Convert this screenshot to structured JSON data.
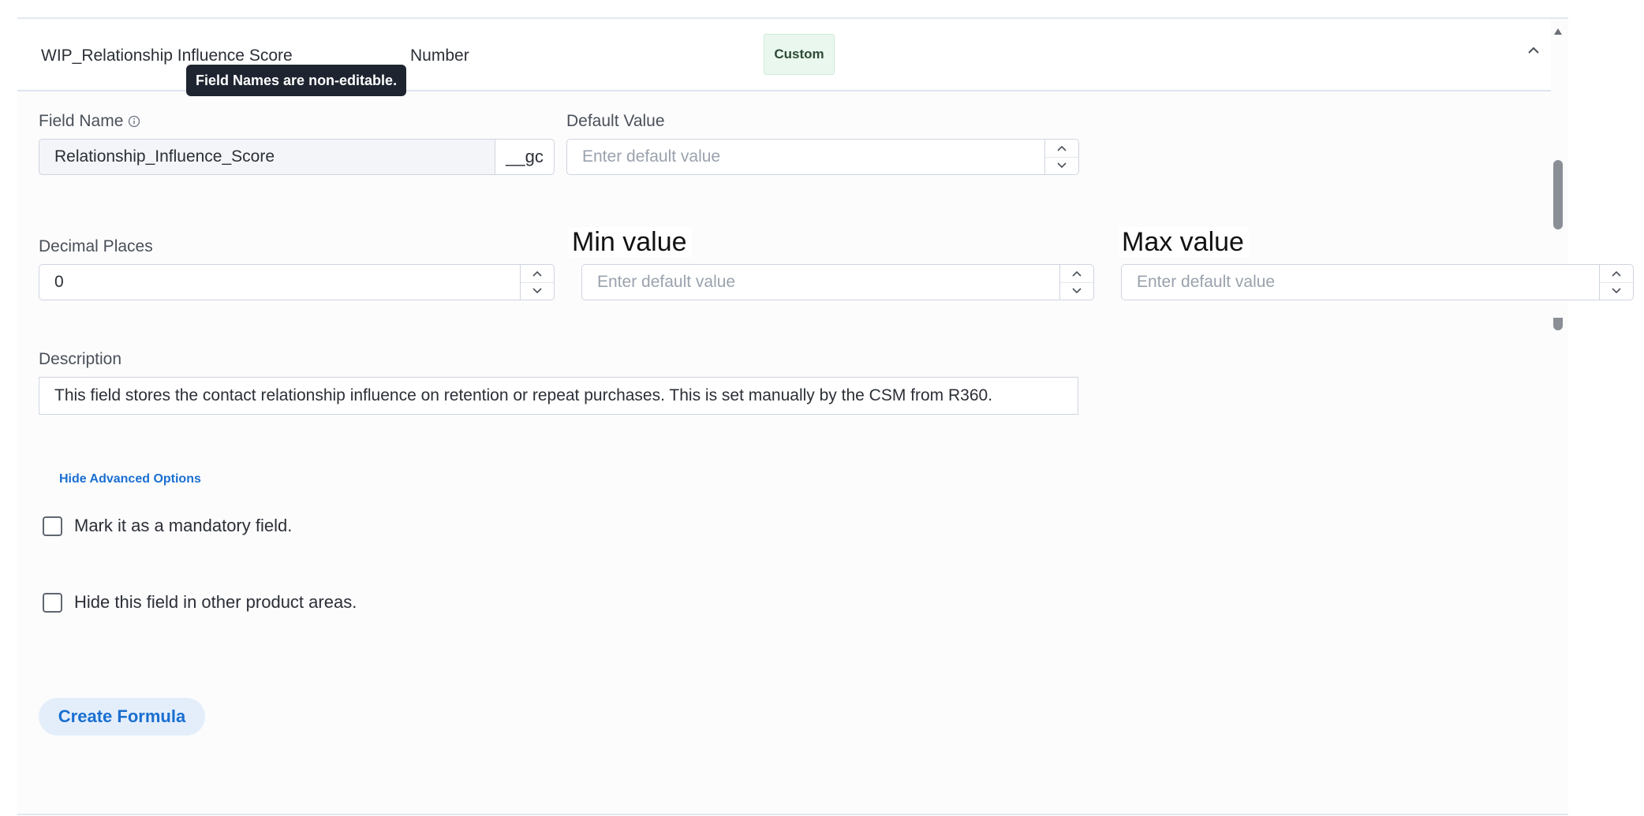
{
  "field_row": {
    "name": "WIP_Relationship Influence Score",
    "type": "Number",
    "badge": "Custom"
  },
  "tooltip": "Field Names are non-editable.",
  "field_name": {
    "label": "Field Name",
    "value": "Relationship_Influence_Score",
    "suffix": "__gc"
  },
  "default_value": {
    "label": "Default Value",
    "placeholder": "Enter default value"
  },
  "decimal_places": {
    "label": "Decimal Places",
    "value": "0"
  },
  "min_value": {
    "label": "Min value",
    "placeholder": "Enter default value"
  },
  "max_value": {
    "label": "Max value",
    "placeholder": "Enter default value"
  },
  "description": {
    "label": "Description",
    "value": "This field stores the contact relationship influence on retention or repeat purchases. This is set manually by the CSM from R360."
  },
  "advanced_link": "Hide Advanced Options",
  "checkboxes": [
    {
      "label": "Mark it as a mandatory field.",
      "checked": false
    },
    {
      "label": "Hide this field in other product areas.",
      "checked": false
    }
  ],
  "create_formula": "Create Formula"
}
